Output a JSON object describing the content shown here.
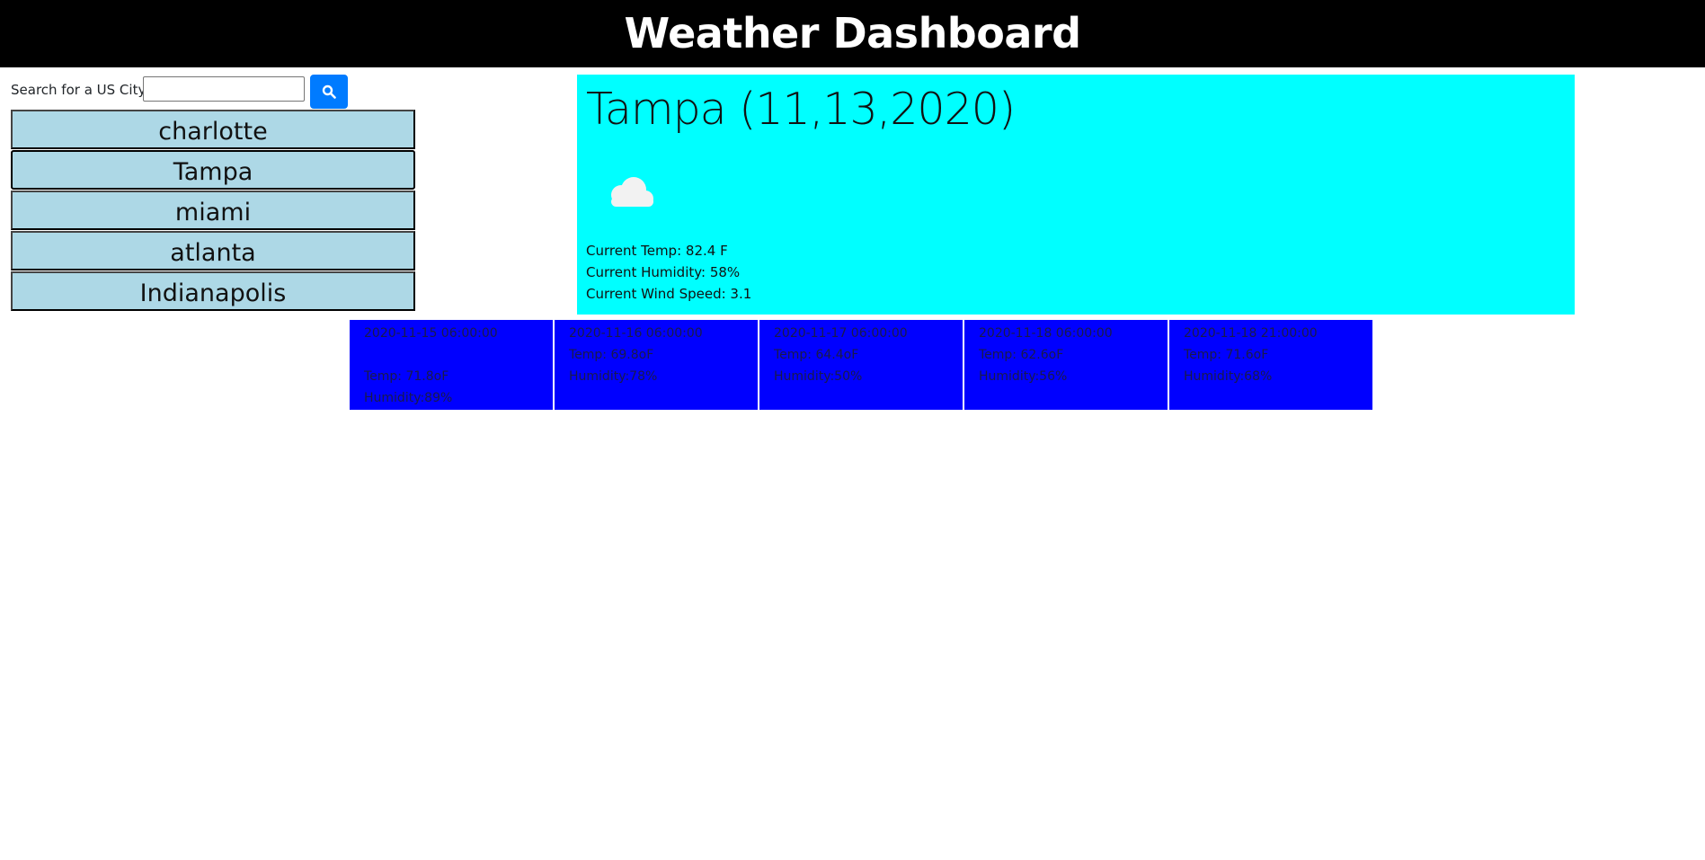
{
  "header": {
    "title": "Weather Dashboard"
  },
  "search": {
    "label": "Search for a US City:",
    "value": "",
    "placeholder": "",
    "button_icon": "search-icon"
  },
  "cities": [
    "charlotte",
    "Tampa",
    "miami",
    "atlanta",
    "Indianapolis"
  ],
  "current": {
    "title": "Tampa (11,13,2020)",
    "icon": "cloud-icon",
    "temp": "Current Temp: 82.4 F",
    "humidity": "Current Humidity: 58%",
    "wind": "Current Wind Speed: 3.1"
  },
  "forecast": [
    {
      "date": "2020-11-15 06:00:00",
      "blank": "",
      "temp": "Temp: 71.8oF",
      "humidity": "Humidity:89%"
    },
    {
      "date": "2020-11-16 06:00:00",
      "temp": "Temp: 69.8oF",
      "humidity": "Humidity:78%"
    },
    {
      "date": "2020-11-17 06:00:00",
      "temp": "Temp: 64.4oF",
      "humidity": "Humidity:50%"
    },
    {
      "date": "2020-11-18 06:00:00",
      "temp": "Temp: 62.6oF",
      "humidity": "Humidity:56%"
    },
    {
      "date": "2020-11-18 21:00:00",
      "temp": "Temp: 71.6oF",
      "humidity": "Humidity:68%"
    }
  ],
  "colors": {
    "header_bg": "#000000",
    "city_bg": "#add8e6",
    "current_bg": "#00ffff",
    "forecast_bg": "#0000ff",
    "search_button": "#007bff"
  }
}
